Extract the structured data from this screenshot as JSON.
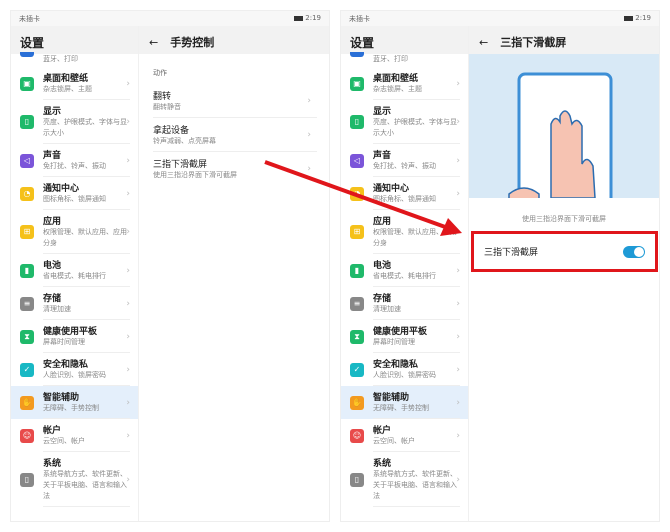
{
  "status": {
    "sim": "未插卡",
    "time": "2:19"
  },
  "sidebar": {
    "title": "设置",
    "partial_subtitle": "蓝牙、打印",
    "items": [
      {
        "title": "桌面和壁纸",
        "subtitle": "杂志锁屏、主题",
        "color": "#1fb96a",
        "icon": "wallpaper-icon",
        "glyph": "▣"
      },
      {
        "title": "显示",
        "subtitle": "亮度、护眼模式、字体与显示大小",
        "color": "#1fb96a",
        "icon": "display-icon",
        "glyph": "▯"
      },
      {
        "title": "声音",
        "subtitle": "免打扰、铃声、振动",
        "color": "#7b55d9",
        "icon": "sound-icon",
        "glyph": "◁"
      },
      {
        "title": "通知中心",
        "subtitle": "图标角标、锁屏通知",
        "color": "#f5c11a",
        "icon": "bell-icon",
        "glyph": "◔"
      },
      {
        "title": "应用",
        "subtitle": "权限管理、默认应用、应用分身",
        "color": "#f5c11a",
        "icon": "apps-icon",
        "glyph": "⊞"
      },
      {
        "title": "电池",
        "subtitle": "省电模式、耗电排行",
        "color": "#1fb96a",
        "icon": "battery-icon",
        "glyph": "▮"
      },
      {
        "title": "存储",
        "subtitle": "清理加速",
        "color": "#888888",
        "icon": "storage-icon",
        "glyph": "≡"
      },
      {
        "title": "健康使用平板",
        "subtitle": "屏幕时间管理",
        "color": "#1fb96a",
        "icon": "hourglass-icon",
        "glyph": "⧗"
      },
      {
        "title": "安全和隐私",
        "subtitle": "人脸识别、锁屏密码",
        "color": "#18b8c4",
        "icon": "shield-icon",
        "glyph": "✓"
      },
      {
        "title": "智能辅助",
        "subtitle": "无障碍、手势控制",
        "color": "#f39a1f",
        "icon": "hand-icon",
        "glyph": "✋",
        "active": true
      },
      {
        "title": "帐户",
        "subtitle": "云空间、帐户",
        "color": "#e84a4a",
        "icon": "account-icon",
        "glyph": "☺"
      },
      {
        "title": "系统",
        "subtitle": "系统导航方式、软件更新、关于平板电脑、语言和输入法",
        "color": "#888888",
        "icon": "system-icon",
        "glyph": "▯"
      }
    ]
  },
  "gesture": {
    "title": "手势控制",
    "group": "动作",
    "items": [
      {
        "title": "翻转",
        "subtitle": "翻转静音"
      },
      {
        "title": "拿起设备",
        "subtitle": "铃声减弱、点亮屏幕"
      },
      {
        "title": "三指下滑截屏",
        "subtitle": "使用三指沿界面下滑可截屏"
      }
    ]
  },
  "screenshot_page": {
    "title": "三指下滑截屏",
    "caption": "使用三指沿界面下滑可截屏",
    "toggle_label": "三指下滑截屏",
    "toggle_on": true
  },
  "colors": {
    "accent": "#1e9ad6",
    "highlight": "#e0161b",
    "arrow": "#e0161b"
  }
}
